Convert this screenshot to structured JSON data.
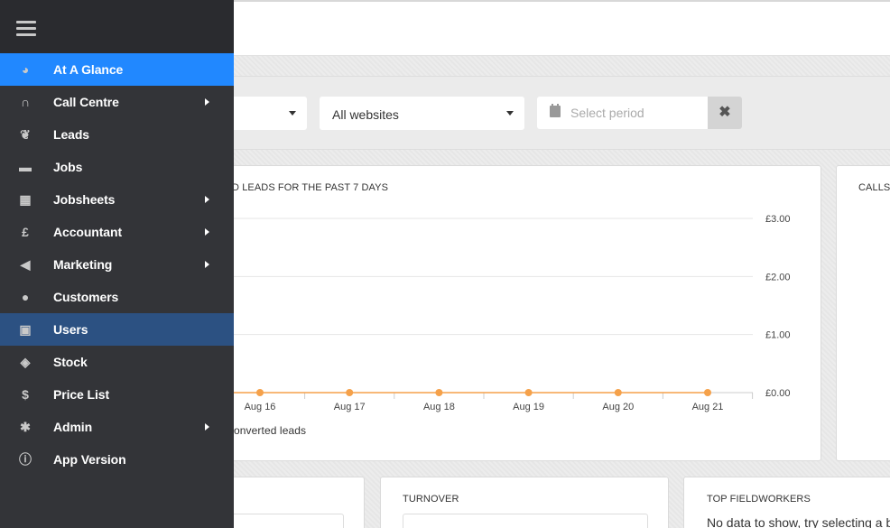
{
  "filters": {
    "site_select": "",
    "websites_select": "All websites",
    "period_placeholder": "Select period",
    "clear_icon": "times-icon",
    "clear_symbol": "✖"
  },
  "chart_card": {
    "title": "D LEADS FOR THE PAST 7 DAYS",
    "legend_label": "onverted leads",
    "series_color": "#f5a14a"
  },
  "chart_data": {
    "type": "line",
    "title": "D LEADS FOR THE PAST 7 DAYS",
    "categories": [
      "Aug 16",
      "Aug 17",
      "Aug 18",
      "Aug 19",
      "Aug 20",
      "Aug 21"
    ],
    "series": [
      {
        "name": "onverted leads",
        "values": [
          0,
          0,
          0,
          0,
          0,
          0
        ]
      }
    ],
    "y_ticks": [
      "£3.00",
      "£2.00",
      "£1.00",
      "£0.00"
    ],
    "ylim": [
      0,
      3
    ],
    "grid": true,
    "y_axis_side": "right"
  },
  "calls_card": {
    "title": "CALLS"
  },
  "bottom_cards": {
    "turnover_title": "TURNOVER",
    "fieldworkers_title": "TOP FIELDWORKERS",
    "fieldworkers_empty": "No data to show, try selecting a b"
  },
  "sidebar": {
    "menu_icon": "hamburger-icon",
    "active_color": "#2188ff",
    "current_color": "#2c5182",
    "items": [
      {
        "label": "At A Glance",
        "icon": "dashboard-icon",
        "glyph": "◕"
      },
      {
        "label": "Call Centre",
        "icon": "headset-icon",
        "glyph": "∩"
      },
      {
        "label": "Leads",
        "icon": "leaf-icon",
        "glyph": "❦"
      },
      {
        "label": "Jobs",
        "icon": "briefcase-icon",
        "glyph": "▬"
      },
      {
        "label": "Jobsheets",
        "icon": "table-icon",
        "glyph": "▦"
      },
      {
        "label": "Accountant",
        "icon": "pound-icon",
        "glyph": "£"
      },
      {
        "label": "Marketing",
        "icon": "bullhorn-icon",
        "glyph": "◀"
      },
      {
        "label": "Customers",
        "icon": "users-icon",
        "glyph": "●"
      },
      {
        "label": "Users",
        "icon": "id-badge-icon",
        "glyph": "▣"
      },
      {
        "label": "Stock",
        "icon": "cubes-icon",
        "glyph": "◈"
      },
      {
        "label": "Price List",
        "icon": "dollar-icon",
        "glyph": "$"
      },
      {
        "label": "Admin",
        "icon": "gear-icon",
        "glyph": "✱"
      },
      {
        "label": "App Version",
        "icon": "info-icon",
        "glyph": "ⓘ"
      }
    ]
  }
}
